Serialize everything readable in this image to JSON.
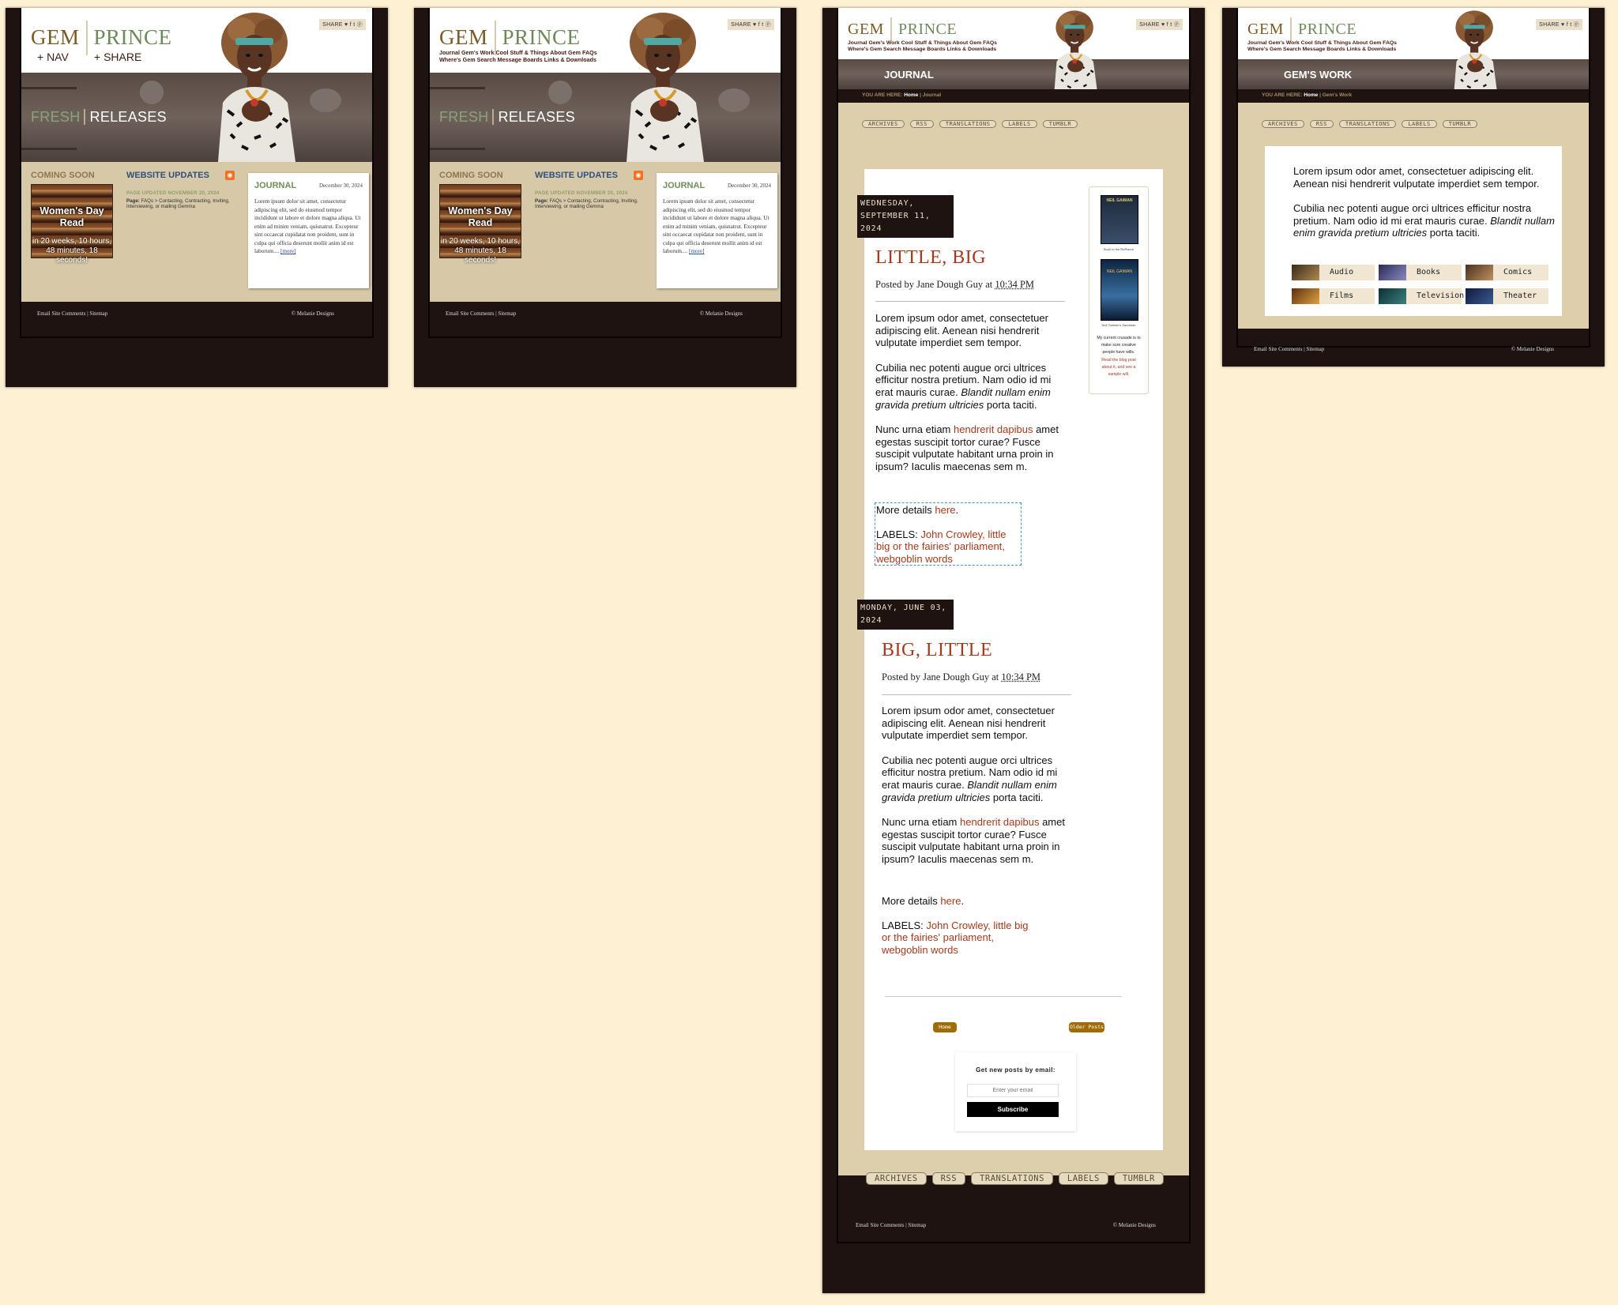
{
  "brand": {
    "gem": "GEM",
    "prince": "PRINCE"
  },
  "share": "SHARE ♥ f t ⓟ",
  "mobile_nav": {
    "nav": "+ NAV",
    "share": "+ SHARE"
  },
  "nav_links_line1": "Journal  Gem's Work  Cool Stuff & Things  About Gem  FAQs",
  "nav_links_line2": "Where's Gem  Search  Message Boards  Links & Downloads",
  "home": {
    "hero_fresh": "FRESH",
    "hero_releases": "RELEASES",
    "coming_soon": "COMING SOON",
    "book_title": "Women's Day Read",
    "book_sub": "in 20 weeks, 10 hours, 48 minutes, 18 seconds!",
    "website_updates": "WEBSITE UPDATES",
    "page_updated": "PAGE UPDATED NOVEMBER 20, 2024",
    "page_label": "Page:",
    "page_desc": "FAQs > Contacting, Contracting, Inviting, Interviewing, or mailing Gemma",
    "journal_title": "JOURNAL",
    "journal_date": "December 30, 2024",
    "journal_text": "Lorem ipsum dolor sit amet, consectetur adipiscing elit, sed do eiusmod tempor incididunt ut labore et dolore magna aliqua. Ut enim ad minim veniam, quisnatrut. Excepteur sint occaecat cupidatat non proident, sunt in culpa qui officia deserunt mollit anim id est laborum.... ",
    "journal_more": "[more]"
  },
  "footer": {
    "left": "Email Site Comments | Sitemap",
    "right": "© Melanie Designs"
  },
  "journal_page": {
    "hero_title": "JOURNAL",
    "crumb_label": "YOU ARE HERE:",
    "crumb_home": "Home",
    "crumb_current": "Journal",
    "tabs": [
      "ARCHIVES",
      "RSS",
      "TRANSLATIONS",
      "LABELS",
      "TUMBLR"
    ],
    "posts": [
      {
        "date": "WEDNESDAY, SEPTEMBER 11, 2024",
        "title": "LITTLE, BIG",
        "meta_prefix": "Posted by Jane Dough Guy at ",
        "meta_time": "10:34 PM",
        "p1": "Lorem ipsum odor amet, consectetuer adipiscing elit. Aenean nisi hendrerit vulputate imperdiet sem tempor.",
        "p2a": "Cubilia nec potenti augue orci ultrices efficitur nostra pretium. Nam odio id mi erat mauris curae. ",
        "p2i": "Blandit nullam enim gravida pretium ultricies",
        "p2b": " porta taciti.",
        "p3a": "Nunc urna etiam ",
        "p3link": "hendrerit dapibus",
        "p3b": " amet egestas suscipit tortor curae? Fusce suscipit vulputate habitant urna proin in ipsum? Iaculis maecenas sem m.",
        "more_a": "More details ",
        "more_link": "here",
        "labels_prefix": "LABELS: ",
        "labels": "John Crowley, little big or the fairies' parliament, webgoblin words"
      },
      {
        "date": "MONDAY, JUNE 03, 2024",
        "title": "BIG, LITTLE",
        "meta_prefix": "Posted by Jane Dough Guy at ",
        "meta_time": "10:34 PM",
        "p1": "Lorem ipsum odor amet, consectetuer adipiscing elit. Aenean nisi hendrerit vulputate imperdiet sem tempor.",
        "p2a": "Cubilia nec potenti augue orci ultrices efficitur nostra pretium. Nam odio id mi erat mauris curae. ",
        "p2i": "Blandit nullam enim gravida pretium ultricies",
        "p2b": " porta taciti.",
        "p3a": "Nunc urna etiam ",
        "p3link": "hendrerit dapibus",
        "p3b": " amet egestas suscipit tortor curae? Fusce suscipit vulputate habitant urna proin in ipsum? Iaculis maecenas sem m.",
        "more_a": "More details ",
        "more_link": "here",
        "labels_prefix": "LABELS: ",
        "labels": "John Crowley, little big or the fairies' parliament, webgoblin words"
      }
    ],
    "btn_home": "Home",
    "btn_older": "Older Posts",
    "subscribe_title": "Get new posts by email:",
    "subscribe_placeholder": "Enter your email",
    "subscribe_button": "Subscribe",
    "side_book1_author": "NEIL GAIMAN",
    "side_book1_caption": "Book to the ReRanch",
    "side_book2_author": "NEIL GAIMAN",
    "side_book2_caption": "Neil Gaiman's Sandman",
    "side_text": "My current crusade is to make sure creative people have wills.",
    "side_link": "Read the blog post about it, and see a sample will."
  },
  "work_page": {
    "hero_title": "GEM'S WORK",
    "crumb_current": "Gem's Work",
    "p1": "Lorem ipsum odor amet, consectetuer adipiscing elit. Aenean nisi hendrerit vulputate imperdiet sem tempor.",
    "p2a": "Cubilia nec potenti augue orci ultrices efficitur nostra pretium. Nam odio id mi erat mauris curae. ",
    "p2i": "Blandit nullam enim gravida pretium ultricies",
    "p2b": " porta taciti.",
    "categories": [
      "Audio",
      "Books",
      "Comics",
      "Films",
      "Television",
      "Theater"
    ]
  },
  "colors": {
    "brown": "#1e1311",
    "tan": "#d7c9a8",
    "accent_red": "#a5391b",
    "green": "#6e8a5a",
    "gold": "#7b5b25",
    "button": "#a06c08"
  }
}
